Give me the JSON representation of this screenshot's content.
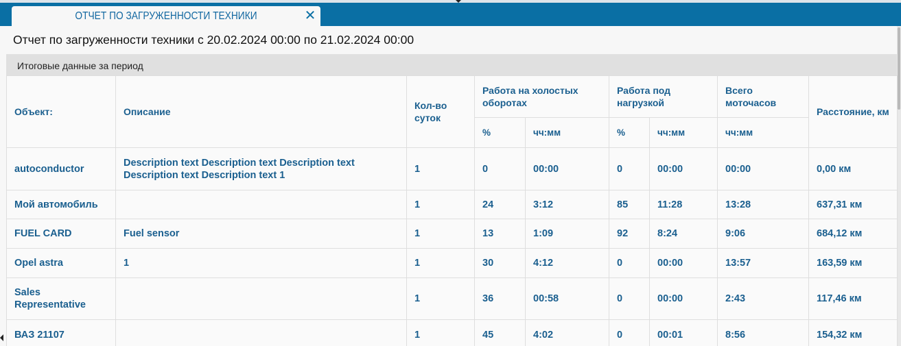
{
  "tab": {
    "title": "ОТЧЕТ ПО ЗАГРУЖЕННОСТИ ТЕХНИКИ",
    "close_symbol": "✕"
  },
  "report": {
    "title": "Отчет по загруженности техники с 20.02.2024 00:00 по 21.02.2024 00:00",
    "section_label": "Итоговые данные за период"
  },
  "table": {
    "headers": {
      "object": "Объект:",
      "description": "Описание",
      "days": "Кол-во суток",
      "idle": "Работа на холостых оборотах",
      "load": "Работа под нагрузкой",
      "total": "Всего моточасов",
      "distance": "Расстояние, км",
      "percent": "%",
      "hhmm": "чч:мм"
    },
    "rows": [
      {
        "object": "autoconductor",
        "description": "Description text Description text Description text Description text Description text 1",
        "days": "1",
        "idle_pct": "0",
        "idle_time": "00:00",
        "load_pct": "0",
        "load_time": "00:00",
        "total": "00:00",
        "distance": "0,00 км"
      },
      {
        "object": "Мой автомобиль",
        "description": "",
        "days": "1",
        "idle_pct": "24",
        "idle_time": "3:12",
        "load_pct": "85",
        "load_time": "11:28",
        "total": "13:28",
        "distance": "637,31 км"
      },
      {
        "object": "FUEL CARD",
        "description": "Fuel sensor",
        "days": "1",
        "idle_pct": "13",
        "idle_time": "1:09",
        "load_pct": "92",
        "load_time": "8:24",
        "total": "9:06",
        "distance": "684,12 км"
      },
      {
        "object": "Opel astra",
        "description": "1",
        "days": "1",
        "idle_pct": "30",
        "idle_time": "4:12",
        "load_pct": "0",
        "load_time": "00:00",
        "total": "13:57",
        "distance": "163,59 км"
      },
      {
        "object": "Sales Representative",
        "description": "",
        "days": "1",
        "idle_pct": "36",
        "idle_time": "00:58",
        "load_pct": "0",
        "load_time": "00:00",
        "total": "2:43",
        "distance": "117,46 км"
      },
      {
        "object": "ВАЗ 21107",
        "description": "",
        "days": "1",
        "idle_pct": "45",
        "idle_time": "4:02",
        "load_pct": "0",
        "load_time": "00:01",
        "total": "8:56",
        "distance": "154,32 км"
      }
    ]
  }
}
